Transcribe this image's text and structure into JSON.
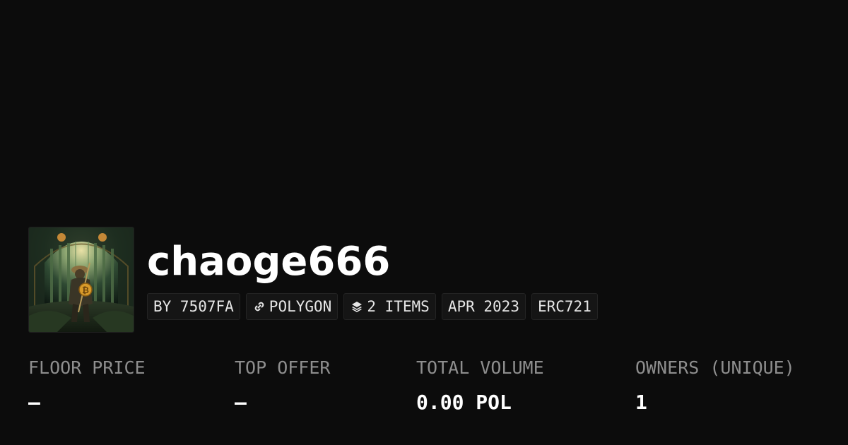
{
  "collection": {
    "name": "chaoge666",
    "badges": {
      "creator": "BY 7507FA",
      "chain": "POLYGON",
      "items": "2 ITEMS",
      "date": "APR 2023",
      "standard": "ERC721"
    },
    "icons": {
      "chain": "polygon-link-icon",
      "items": "layers-icon"
    },
    "image": "samurai-bitcoin-forest-artwork"
  },
  "stats": [
    {
      "label": "FLOOR PRICE",
      "value": "–"
    },
    {
      "label": "TOP OFFER",
      "value": "–"
    },
    {
      "label": "TOTAL VOLUME",
      "value": "0.00 POL"
    },
    {
      "label": "OWNERS (UNIQUE)",
      "value": "1"
    }
  ],
  "colors": {
    "background": "#0c0c0c",
    "badge_background": "#151515",
    "label_gray": "#8e8e8e",
    "text_white": "#ffffff"
  }
}
